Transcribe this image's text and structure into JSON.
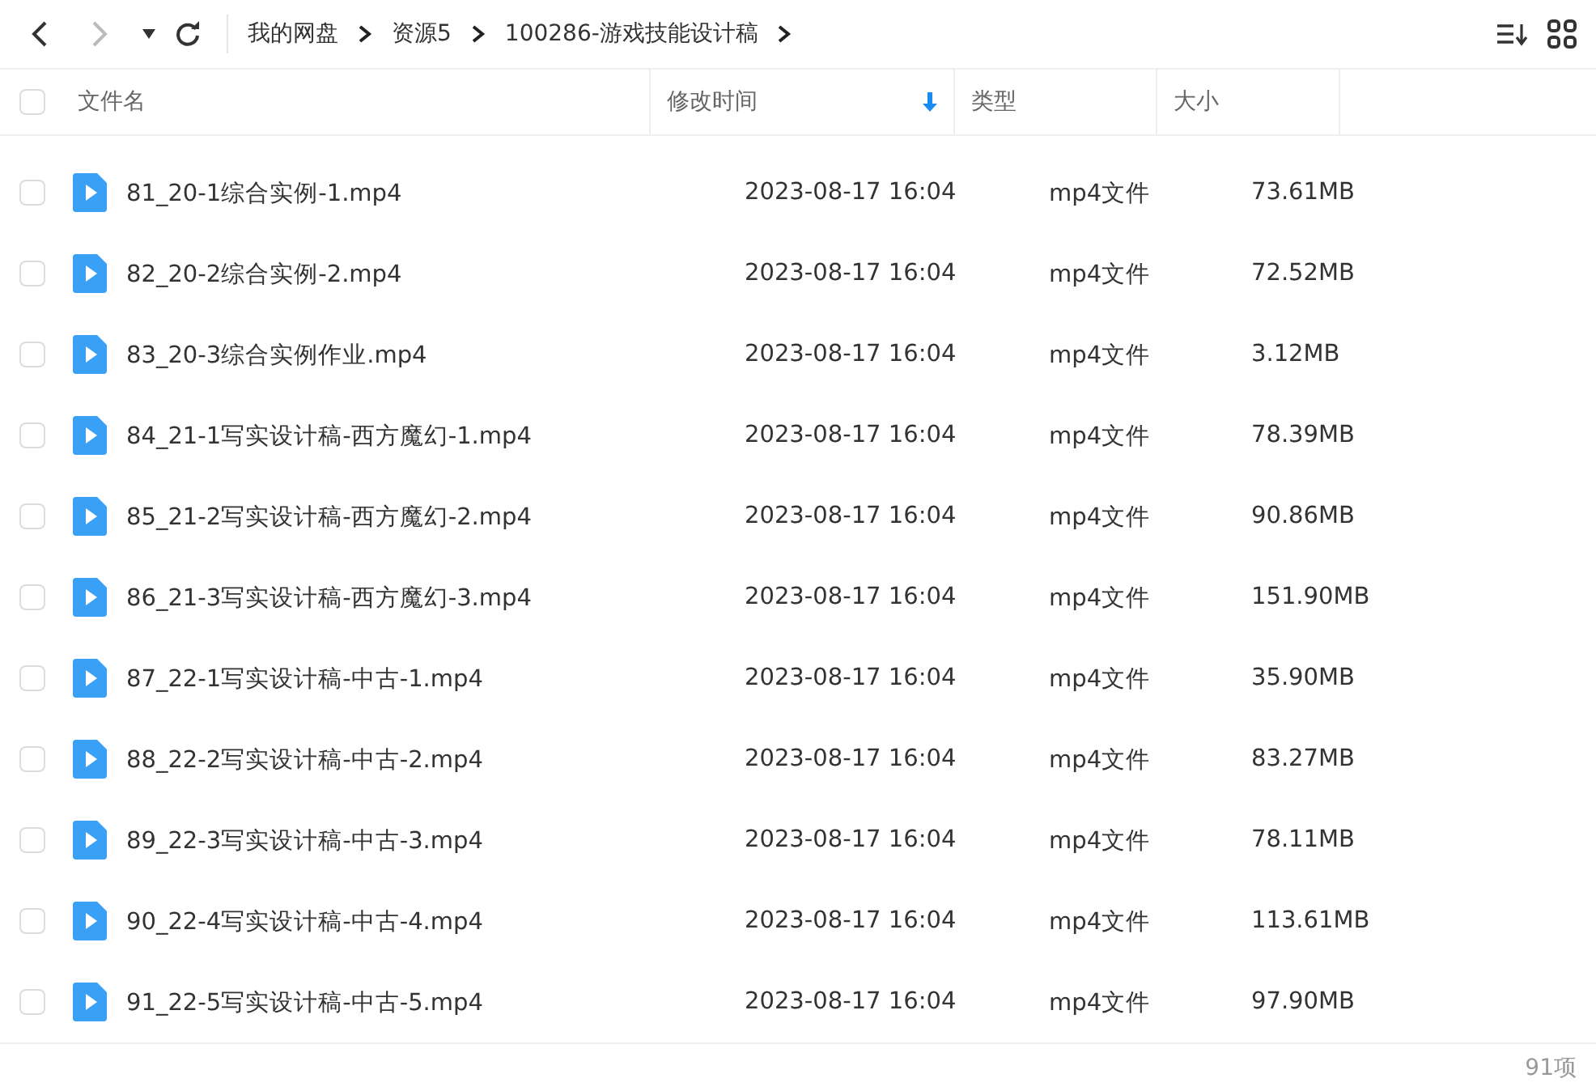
{
  "nav": {
    "back": {
      "disabled": false
    },
    "forward": {
      "disabled": true
    }
  },
  "breadcrumbs": [
    "我的网盘",
    "资源5",
    "100286-游戏技能设计稿"
  ],
  "table": {
    "select_all": {
      "checked": false
    },
    "columns": [
      {
        "label": "文件名",
        "sorted": false
      },
      {
        "label": "修改时间",
        "sorted": true
      },
      {
        "label": "类型",
        "sorted": false
      },
      {
        "label": "大小",
        "sorted": false
      }
    ],
    "rows": [
      {
        "name": "81_20-1综合实例-1.mp4",
        "modified": "2023-08-17 16:04",
        "type": "mp4文件",
        "size": "73.61MB",
        "checked": false
      },
      {
        "name": "82_20-2综合实例-2.mp4",
        "modified": "2023-08-17 16:04",
        "type": "mp4文件",
        "size": "72.52MB",
        "checked": false
      },
      {
        "name": "83_20-3综合实例作业.mp4",
        "modified": "2023-08-17 16:04",
        "type": "mp4文件",
        "size": "3.12MB",
        "checked": false
      },
      {
        "name": "84_21-1写实设计稿-西方魔幻-1.mp4",
        "modified": "2023-08-17 16:04",
        "type": "mp4文件",
        "size": "78.39MB",
        "checked": false
      },
      {
        "name": "85_21-2写实设计稿-西方魔幻-2.mp4",
        "modified": "2023-08-17 16:04",
        "type": "mp4文件",
        "size": "90.86MB",
        "checked": false
      },
      {
        "name": "86_21-3写实设计稿-西方魔幻-3.mp4",
        "modified": "2023-08-17 16:04",
        "type": "mp4文件",
        "size": "151.90MB",
        "checked": false
      },
      {
        "name": "87_22-1写实设计稿-中古-1.mp4",
        "modified": "2023-08-17 16:04",
        "type": "mp4文件",
        "size": "35.90MB",
        "checked": false
      },
      {
        "name": "88_22-2写实设计稿-中古-2.mp4",
        "modified": "2023-08-17 16:04",
        "type": "mp4文件",
        "size": "83.27MB",
        "checked": false
      },
      {
        "name": "89_22-3写实设计稿-中古-3.mp4",
        "modified": "2023-08-17 16:04",
        "type": "mp4文件",
        "size": "78.11MB",
        "checked": false
      },
      {
        "name": "90_22-4写实设计稿-中古-4.mp4",
        "modified": "2023-08-17 16:04",
        "type": "mp4文件",
        "size": "113.61MB",
        "checked": false
      },
      {
        "name": "91_22-5写实设计稿-中古-5.mp4",
        "modified": "2023-08-17 16:04",
        "type": "mp4文件",
        "size": "97.90MB",
        "checked": false
      }
    ]
  },
  "status_bar": {
    "count": "91项"
  }
}
